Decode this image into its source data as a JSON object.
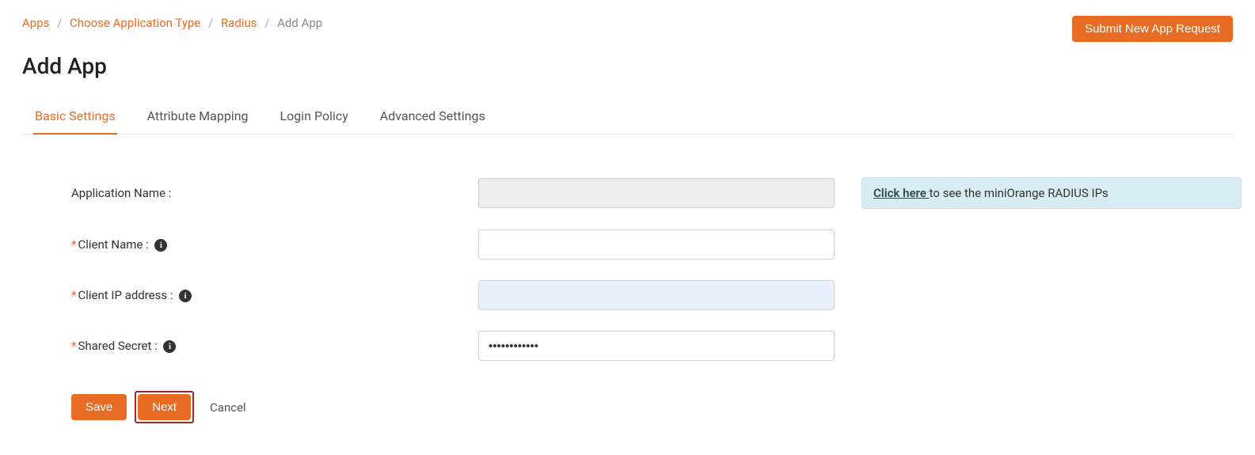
{
  "breadcrumb": {
    "items": [
      {
        "label": "Apps"
      },
      {
        "label": "Choose Application Type"
      },
      {
        "label": "Radius"
      }
    ],
    "current": "Add App"
  },
  "header": {
    "submit_button": "Submit New App Request",
    "page_title": "Add App"
  },
  "tabs": [
    {
      "label": "Basic Settings",
      "active": true
    },
    {
      "label": "Attribute Mapping",
      "active": false
    },
    {
      "label": "Login Policy",
      "active": false
    },
    {
      "label": "Advanced Settings",
      "active": false
    }
  ],
  "form": {
    "application_name": {
      "label": "Application Name :",
      "value": ""
    },
    "client_name": {
      "label": "Client Name :",
      "value": ""
    },
    "client_ip": {
      "label": "Client IP address :",
      "value": ""
    },
    "shared_secret": {
      "label": "Shared Secret :",
      "value": "••••••••••••"
    }
  },
  "info_panel": {
    "link_text": "Click here ",
    "rest_text": "to see the miniOrange RADIUS IPs"
  },
  "buttons": {
    "save": "Save",
    "next": "Next",
    "cancel": "Cancel"
  }
}
